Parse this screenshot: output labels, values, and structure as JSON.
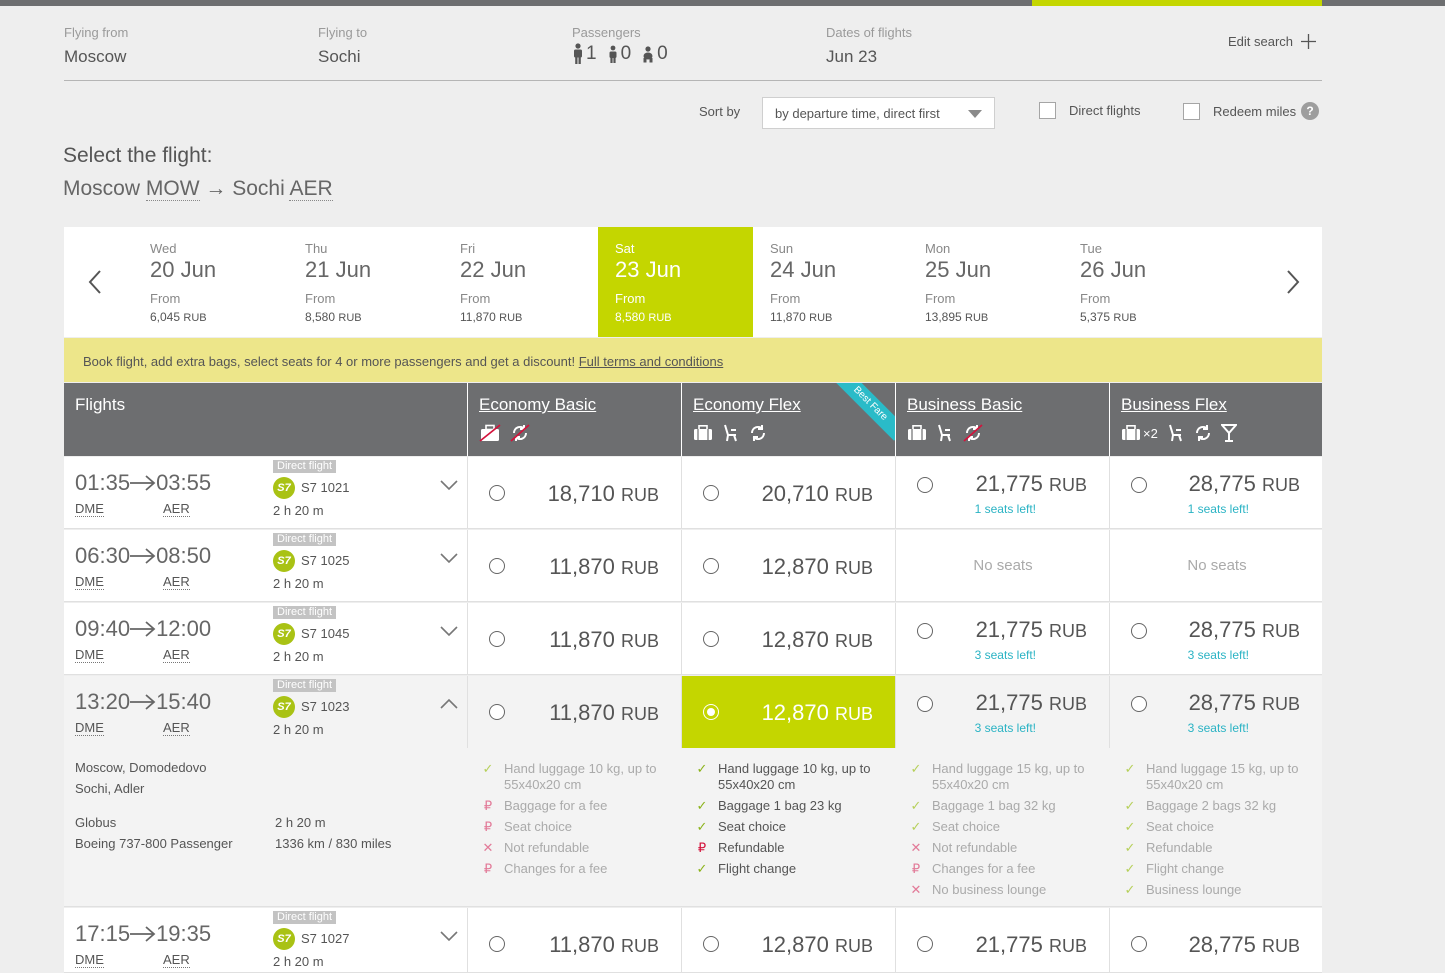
{
  "search": {
    "from_label": "Flying from",
    "from": "Moscow",
    "to_label": "Flying to",
    "to": "Sochi",
    "passengers_label": "Passengers",
    "adults": "1",
    "children": "0",
    "infants": "0",
    "dates_label": "Dates of flights",
    "date": "Jun 23",
    "edit": "Edit search"
  },
  "sort": {
    "label": "Sort by",
    "value": "by departure time, direct first",
    "direct": "Direct flights",
    "redeem": "Redeem miles",
    "help": "?"
  },
  "heading": "Select the flight:",
  "route": {
    "from_city": "Moscow",
    "from_code": "MOW",
    "arrow": "→",
    "to_city": "Sochi",
    "to_code": "AER"
  },
  "dates": [
    {
      "dow": "Wed",
      "day": "20 Jun",
      "from": "From",
      "price": "6,045",
      "cur": "RUB"
    },
    {
      "dow": "Thu",
      "day": "21 Jun",
      "from": "From",
      "price": "8,580",
      "cur": "RUB"
    },
    {
      "dow": "Fri",
      "day": "22 Jun",
      "from": "From",
      "price": "11,870",
      "cur": "RUB"
    },
    {
      "dow": "Sat",
      "day": "23 Jun",
      "from": "From",
      "price": "8,580",
      "cur": "RUB"
    },
    {
      "dow": "Sun",
      "day": "24 Jun",
      "from": "From",
      "price": "11,870",
      "cur": "RUB"
    },
    {
      "dow": "Mon",
      "day": "25 Jun",
      "from": "From",
      "price": "13,895",
      "cur": "RUB"
    },
    {
      "dow": "Tue",
      "day": "26 Jun",
      "from": "From",
      "price": "5,375",
      "cur": "RUB"
    }
  ],
  "promo": {
    "text": "Book flight, add extra bags, select seats for 4 or more passengers and get a discount! ",
    "link": "Full terms and conditions"
  },
  "table": {
    "flights_label": "Flights",
    "fares": [
      "Economy Basic",
      "Economy Flex",
      "Business Basic",
      "Business Flex"
    ],
    "best": "Best Fare",
    "bag_mult": "×2"
  },
  "currency": "RUB",
  "no_seats": "No seats",
  "flights": [
    {
      "dep": "01:35",
      "arr": "03:55",
      "from": "DME",
      "to": "AER",
      "badge": "Direct flight",
      "airline": "S7",
      "num": "S7 1021",
      "dur": "2 h 20 m",
      "p": [
        "18,710",
        "20,710",
        "21,775",
        "28,775"
      ],
      "s": [
        "",
        "",
        "1 seats left!",
        "1 seats left!"
      ]
    },
    {
      "dep": "06:30",
      "arr": "08:50",
      "from": "DME",
      "to": "AER",
      "badge": "Direct flight",
      "airline": "S7",
      "num": "S7 1025",
      "dur": "2 h 20 m",
      "p": [
        "11,870",
        "12,870",
        "",
        ""
      ],
      "s": [
        "",
        "",
        "",
        ""
      ]
    },
    {
      "dep": "09:40",
      "arr": "12:00",
      "from": "DME",
      "to": "AER",
      "badge": "Direct flight",
      "airline": "S7",
      "num": "S7 1045",
      "dur": "2 h 20 m",
      "p": [
        "11,870",
        "12,870",
        "21,775",
        "28,775"
      ],
      "s": [
        "",
        "",
        "3 seats left!",
        "3 seats left!"
      ]
    },
    {
      "dep": "13:20",
      "arr": "15:40",
      "from": "DME",
      "to": "AER",
      "badge": "Direct flight",
      "airline": "S7",
      "num": "S7 1023",
      "dur": "2 h 20 m",
      "p": [
        "11,870",
        "12,870",
        "21,775",
        "28,775"
      ],
      "s": [
        "",
        "",
        "3 seats left!",
        "3 seats left!"
      ]
    },
    {
      "dep": "17:15",
      "arr": "19:35",
      "from": "DME",
      "to": "AER",
      "badge": "Direct flight",
      "airline": "S7",
      "num": "S7 1027",
      "dur": "2 h 20 m",
      "p": [
        "11,870",
        "12,870",
        "21,775",
        "28,775"
      ],
      "s": [
        "",
        "",
        "",
        ""
      ]
    }
  ],
  "details": {
    "dep_airport": "Moscow, Domodedovo",
    "arr_airport": "Sochi, Adler",
    "operator": "Globus",
    "aircraft": "Boeing 737-800 Passenger",
    "duration": "2 h 20 m",
    "distance": "1336 km / 830 miles",
    "features": [
      [
        {
          "mark": "check",
          "text": "Hand luggage 10 kg, up to 55x40x20 cm"
        },
        {
          "mark": "fee",
          "text": "Baggage for a fee"
        },
        {
          "mark": "fee",
          "text": "Seat choice"
        },
        {
          "mark": "cross",
          "text": "Not refundable"
        },
        {
          "mark": "fee",
          "text": "Changes for a fee"
        }
      ],
      [
        {
          "mark": "check",
          "text": "Hand luggage 10 kg, up to 55x40x20 cm"
        },
        {
          "mark": "check",
          "text": "Baggage 1 bag 23 kg"
        },
        {
          "mark": "check",
          "text": "Seat choice"
        },
        {
          "mark": "fee",
          "text": "Refundable"
        },
        {
          "mark": "check",
          "text": "Flight change"
        }
      ],
      [
        {
          "mark": "check",
          "text": "Hand luggage 15 kg, up to 55x40x20 cm"
        },
        {
          "mark": "check",
          "text": "Baggage 1 bag 32 kg"
        },
        {
          "mark": "check",
          "text": "Seat choice"
        },
        {
          "mark": "cross",
          "text": "Not refundable"
        },
        {
          "mark": "fee",
          "text": "Changes for a fee"
        },
        {
          "mark": "cross",
          "text": "No business lounge"
        }
      ],
      [
        {
          "mark": "check",
          "text": "Hand luggage 15 kg, up to 55x40x20 cm"
        },
        {
          "mark": "check",
          "text": "Baggage 2 bags 32 kg"
        },
        {
          "mark": "check",
          "text": "Seat choice"
        },
        {
          "mark": "check",
          "text": "Refundable"
        },
        {
          "mark": "check",
          "text": "Flight change"
        },
        {
          "mark": "check",
          "text": "Business lounge"
        }
      ]
    ]
  },
  "colors": {
    "accent": "#c4d600",
    "header": "#6d6e70",
    "seats": "#2ab3c4",
    "promo": "#ede68a",
    "ribbon": "#2abbc8"
  }
}
